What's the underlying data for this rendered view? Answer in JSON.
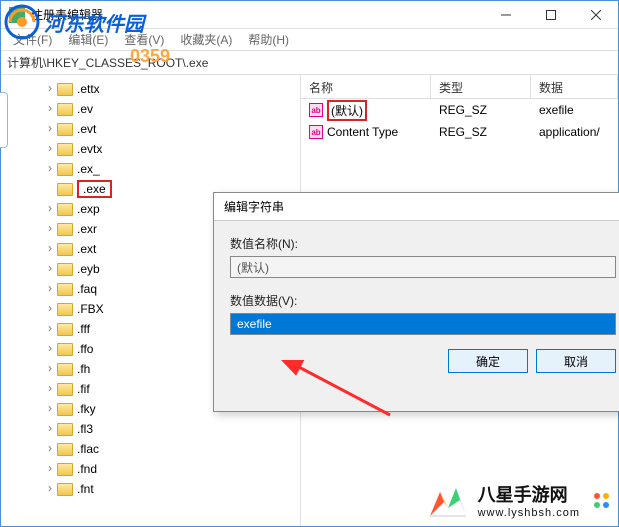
{
  "window": {
    "title": "注册表编辑器",
    "menus": [
      "文件(F)",
      "编辑(E)",
      "查看(V)",
      "收藏夹(A)",
      "帮助(H)"
    ],
    "address": "计算机\\HKEY_CLASSES_ROOT\\.exe"
  },
  "tree": {
    "items": [
      {
        "label": ".ettx"
      },
      {
        "label": ".ev"
      },
      {
        "label": ".evt"
      },
      {
        "label": ".evtx"
      },
      {
        "label": ".ex_"
      },
      {
        "label": ".exe",
        "selected": true
      },
      {
        "label": ".exp"
      },
      {
        "label": ".exr"
      },
      {
        "label": ".ext"
      },
      {
        "label": ".eyb"
      },
      {
        "label": ".faq"
      },
      {
        "label": ".FBX"
      },
      {
        "label": ".fff"
      },
      {
        "label": ".ffo"
      },
      {
        "label": ".fh"
      },
      {
        "label": ".fif"
      },
      {
        "label": ".fky"
      },
      {
        "label": ".fl3"
      },
      {
        "label": ".flac"
      },
      {
        "label": ".fnd"
      },
      {
        "label": ".fnt"
      }
    ]
  },
  "list": {
    "headers": {
      "name": "名称",
      "type": "类型",
      "data": "数据"
    },
    "rows": [
      {
        "name": "(默认)",
        "type": "REG_SZ",
        "data": "exefile",
        "selected": true
      },
      {
        "name": "Content Type",
        "type": "REG_SZ",
        "data": "application/"
      }
    ]
  },
  "dialog": {
    "title": "编辑字符串",
    "name_label": "数值名称(N):",
    "name_value": "(默认)",
    "data_label": "数值数据(V):",
    "data_value": "exefile",
    "ok": "确定",
    "cancel": "取消"
  },
  "watermarks": {
    "hedong": "河东软件园",
    "code": "0359",
    "baxing_name": "八星手游网",
    "baxing_url": "www.lyshbsh.com"
  },
  "colors": {
    "accent": "#0078d7",
    "highlight_border": "#d22",
    "orange": "#ff7f2a"
  }
}
